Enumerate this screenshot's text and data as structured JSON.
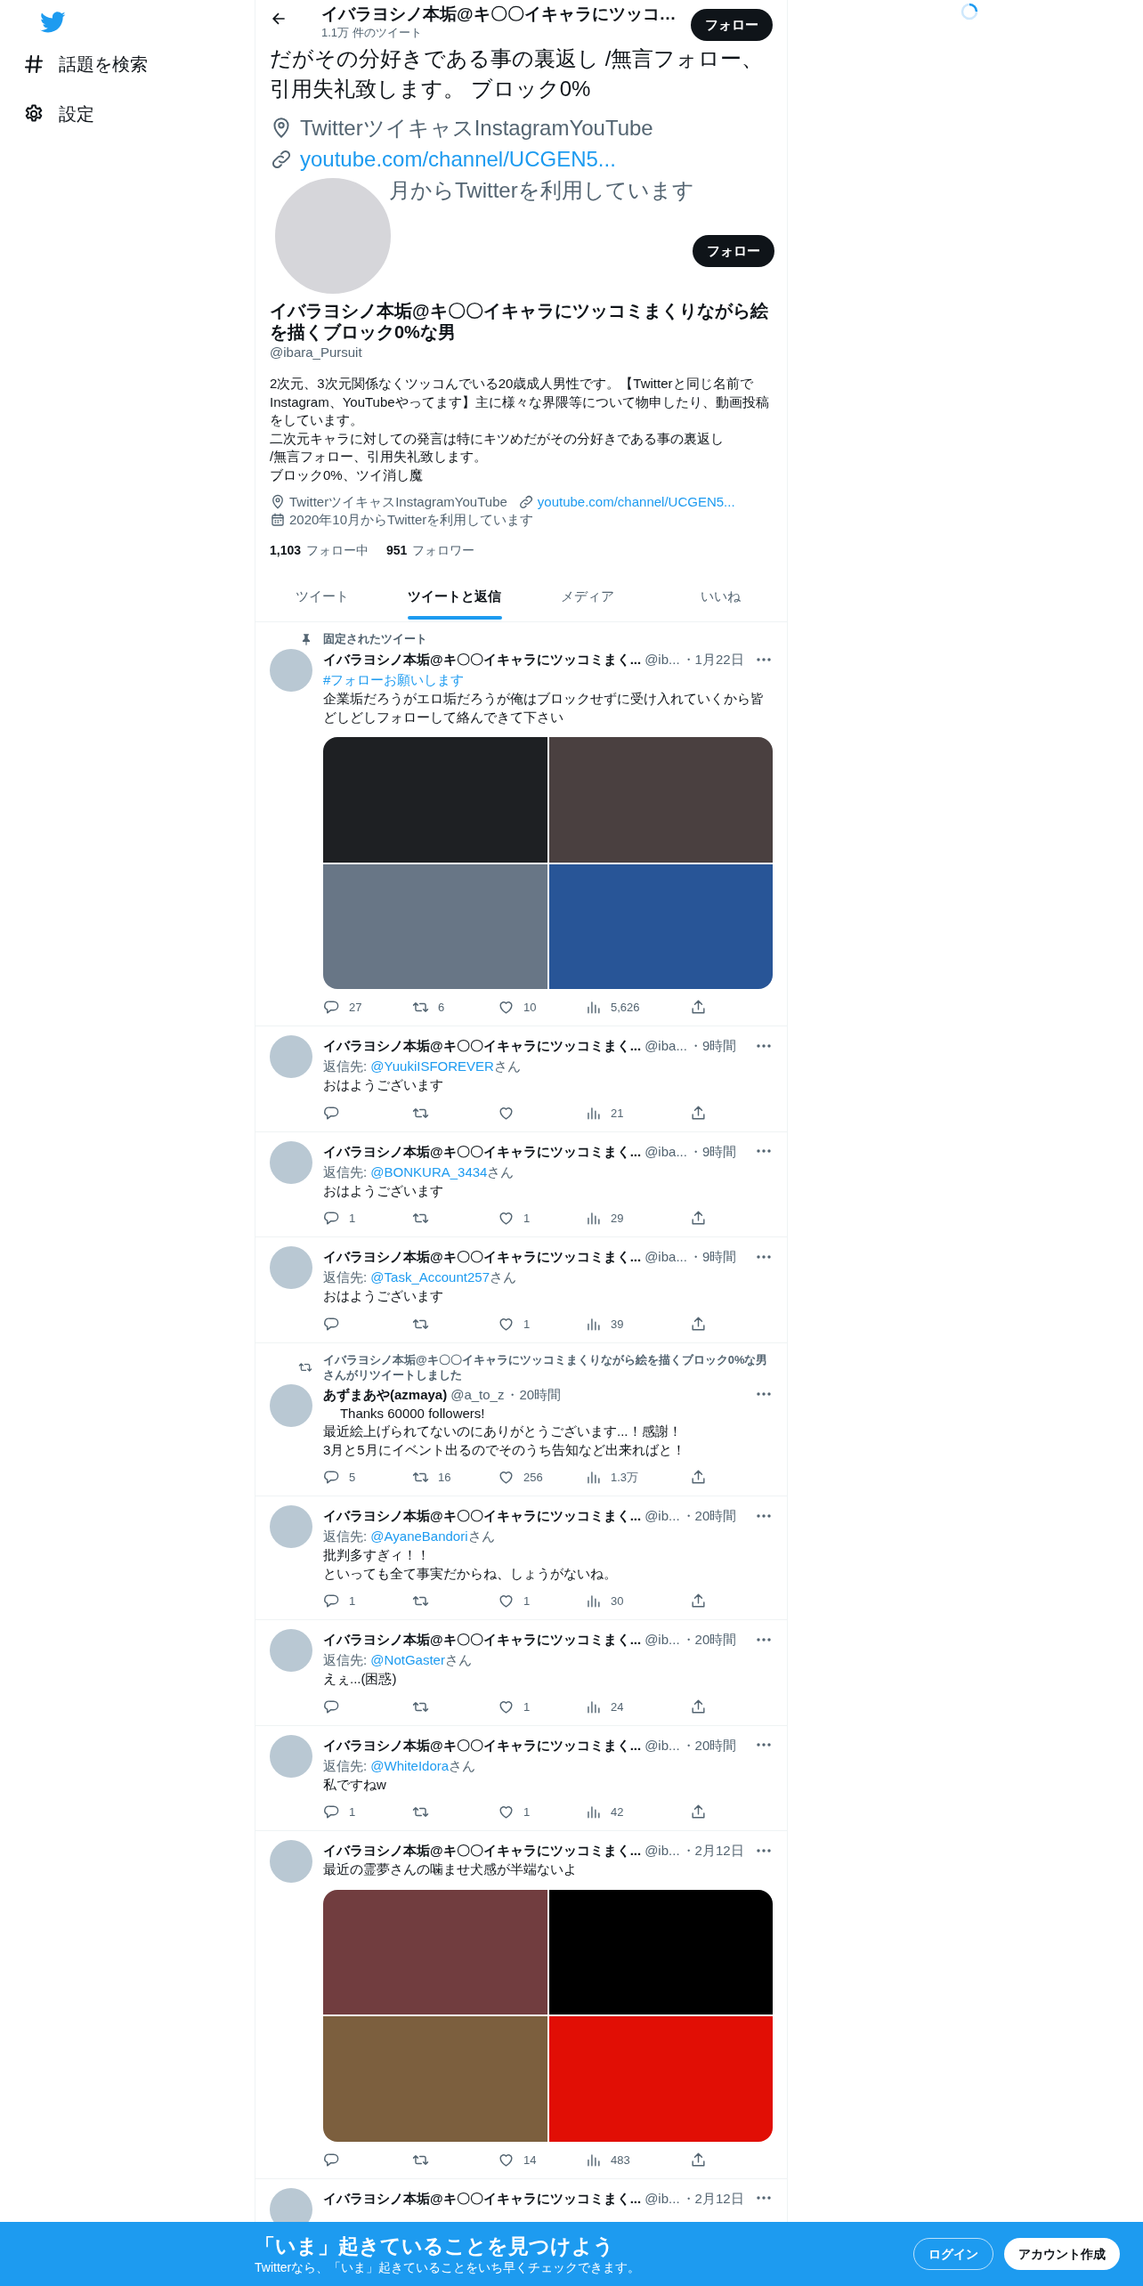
{
  "sidebar": {
    "items": [
      {
        "kind": "explore",
        "label": "話題を検索"
      },
      {
        "kind": "settings",
        "label": "設定"
      }
    ]
  },
  "header": {
    "name": "イバラヨシノ本垢@キ〇〇イキャラにツッコ…",
    "tweet_count": "1.1万 件のツイート",
    "follow_button": "フォロー"
  },
  "overlay": {
    "text": "だがその分好きである事の裏返し /無言フォロー、引用失礼致します。 ブロック0%",
    "location": "TwitterツイキャスInstagramYouTube",
    "link": "youtube.com/channel/UCGEN5...",
    "joined": "月からTwitterを利用しています",
    "follow_button": "フォロー"
  },
  "profile": {
    "name": "イバラヨシノ本垢@キ〇〇イキャラにツッコミまくりながら絵を描くブロック0%な男",
    "handle": "@ibara_Pursuit",
    "bio": [
      "2次元、3次元関係なくツッコんでいる20歳成人男性です。【Twitterと同じ名前でInstagram、YouTubeやってます】主に様々な界隈等について物申したり、動画投稿をしています。",
      "二次元キャラに対しての発言は特にキツめだがその分好きである事の裏返し",
      "/無言フォロー、引用失礼致します。",
      "ブロック0%、ツイ消し魔"
    ],
    "location": "TwitterツイキャスInstagramYouTube",
    "link": "youtube.com/channel/UCGEN5...",
    "joined": "2020年10月からTwitterを利用しています",
    "following_count": "1,103",
    "following_label": "フォロー中",
    "followers_count": "951",
    "followers_label": "フォロワー"
  },
  "tabs": [
    {
      "label": "ツイート",
      "selected": false
    },
    {
      "label": "ツイートと返信",
      "selected": true
    },
    {
      "label": "メディア",
      "selected": false
    },
    {
      "label": "いいね",
      "selected": false
    }
  ],
  "tweets": [
    {
      "pinned_label": "固定されたツイート",
      "name": "イバラヨシノ本垢@キ〇〇イキャラにツッコミまく...",
      "handle": "@ib...",
      "time": "・1月22日",
      "hashtag": "#フォローお願いします",
      "text": "企業垢だろうがエロ垢だろうが俺はブロックせずに受け入れていくから皆どしどしフォローして絡んできて下さい",
      "media": [
        {
          "color": "#1e2023"
        },
        {
          "color": "#4a4040"
        },
        {
          "color": "#687686"
        },
        {
          "color": "#285597"
        }
      ],
      "stats": {
        "replies": "27",
        "retweets": "6",
        "likes": "10",
        "views": "5,626"
      }
    },
    {
      "name": "イバラヨシノ本垢@キ〇〇イキャラにツッコミまく...",
      "handle": "@iba...",
      "time": "・9時間",
      "reply_prefix": "返信先: ",
      "reply_to": "@YuukiISFOREVER",
      "reply_suffix": "さん",
      "text": "おはようございます",
      "stats": {
        "views": "21"
      }
    },
    {
      "name": "イバラヨシノ本垢@キ〇〇イキャラにツッコミまく...",
      "handle": "@iba...",
      "time": "・9時間",
      "reply_prefix": "返信先: ",
      "reply_to": "@BONKURA_3434",
      "reply_suffix": "さん",
      "text": "おはようございます",
      "stats": {
        "replies": "1",
        "likes": "1",
        "views": "29"
      }
    },
    {
      "name": "イバラヨシノ本垢@キ〇〇イキャラにツッコミまく...",
      "handle": "@iba...",
      "time": "・9時間",
      "reply_prefix": "返信先: ",
      "reply_to": "@Task_Account257",
      "reply_suffix": "さん",
      "text": "おはようございます",
      "stats": {
        "likes": "1",
        "views": "39"
      }
    },
    {
      "retweet_label": "イバラヨシノ本垢@キ〇〇イキャラにツッコミまくりながら絵を描くブロック0%な男さんがリツイートしました",
      "name": "あずまあや(azmaya)",
      "handle": "@a_to_z",
      "time": "・20時間",
      "text": [
        "　 Thanks 60000 followers!",
        "最近絵上げられてないのにありがとうございます...！感謝！",
        "3月と5月にイベント出るのでそのうち告知など出来ればと！"
      ],
      "stats": {
        "replies": "5",
        "retweets": "16",
        "likes": "256",
        "views": "1.3万"
      }
    },
    {
      "name": "イバラヨシノ本垢@キ〇〇イキャラにツッコミまく...",
      "handle": "@ib...",
      "time": "・20時間",
      "reply_prefix": "返信先: ",
      "reply_to": "@AyaneBandori",
      "reply_suffix": "さん",
      "text": [
        "批判多すぎィ！！",
        "といっても全て事実だからね、しょうがないね。"
      ],
      "stats": {
        "replies": "1",
        "likes": "1",
        "views": "30"
      }
    },
    {
      "name": "イバラヨシノ本垢@キ〇〇イキャラにツッコミまく...",
      "handle": "@ib...",
      "time": "・20時間",
      "reply_prefix": "返信先: ",
      "reply_to": "@NotGaster",
      "reply_suffix": "さん",
      "text": "えぇ...(困惑)",
      "stats": {
        "likes": "1",
        "views": "24"
      }
    },
    {
      "name": "イバラヨシノ本垢@キ〇〇イキャラにツッコミまく...",
      "handle": "@ib...",
      "time": "・20時間",
      "reply_prefix": "返信先: ",
      "reply_to": "@WhiteIdora",
      "reply_suffix": "さん",
      "text": "私ですねw",
      "stats": {
        "replies": "1",
        "likes": "1",
        "views": "42"
      }
    },
    {
      "name": "イバラヨシノ本垢@キ〇〇イキャラにツッコミまく...",
      "handle": "@ib...",
      "time": "・2月12日",
      "text": "最近の霊夢さんの噛ませ犬感が半端ないよ",
      "media": [
        {
          "color": "#713d3f"
        },
        {
          "color": "#000000"
        },
        {
          "color": "#7c5f3e"
        },
        {
          "color": "#e10e05"
        }
      ],
      "stats": {
        "likes": "14",
        "views": "483"
      }
    },
    {
      "name": "イバラヨシノ本垢@キ〇〇イキャラにツッコミまく...",
      "handle": "@ib...",
      "time": "・2月12日"
    }
  ],
  "banner": {
    "title": "「いま」起きていることを見つけよう",
    "subtitle": "Twitterなら、「いま」起きていることをいち早くチェックできます。",
    "login_button": "ログイン",
    "signup_button": "アカウント作成"
  }
}
